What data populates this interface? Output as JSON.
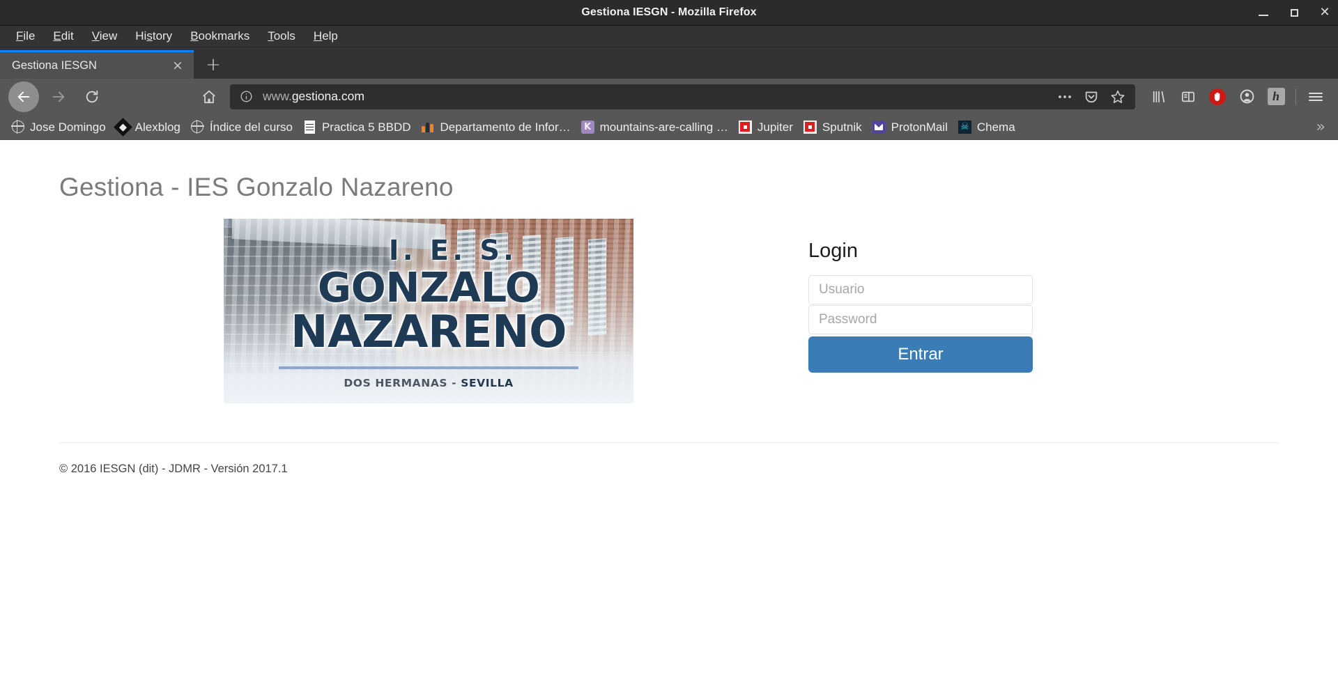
{
  "window": {
    "title": "Gestiona IESGN - Mozilla Firefox",
    "controls": {
      "minimize": "minimize-icon",
      "maximize": "maximize-icon",
      "close": "close-icon"
    }
  },
  "menubar": [
    {
      "label": "File",
      "accel": "F"
    },
    {
      "label": "Edit",
      "accel": "E"
    },
    {
      "label": "View",
      "accel": "V"
    },
    {
      "label": "History",
      "accel": "s"
    },
    {
      "label": "Bookmarks",
      "accel": "B"
    },
    {
      "label": "Tools",
      "accel": "T"
    },
    {
      "label": "Help",
      "accel": "H"
    }
  ],
  "tabs": {
    "active": {
      "title": "Gestiona IESGN",
      "close": "×"
    },
    "new_tab": "+"
  },
  "toolbar": {
    "back": "back-arrow-icon",
    "forward": "forward-arrow-icon",
    "reload": "reload-icon",
    "home": "home-icon",
    "url": {
      "scheme_host_dim": "www.",
      "host": "gestiona.com",
      "info_icon": "info-icon"
    },
    "url_actions": {
      "page_actions": "…",
      "pocket": "pocket-icon",
      "bookmark_star": "star-icon"
    },
    "extensions": [
      {
        "name": "library-icon"
      },
      {
        "name": "sidebar-icon"
      },
      {
        "name": "ublock-origin-icon"
      },
      {
        "name": "account-icon"
      },
      {
        "name": "hypothesis-icon",
        "glyph": "h"
      }
    ],
    "menu": "hamburger-menu-icon"
  },
  "bookmarks": {
    "items": [
      {
        "label": "Jose Domingo",
        "icon": "globe-icon"
      },
      {
        "label": "Alexblog",
        "icon": "diamond-icon"
      },
      {
        "label": "Índice del curso",
        "icon": "globe-icon"
      },
      {
        "label": "Practica 5 BBDD",
        "icon": "document-icon"
      },
      {
        "label": "Departamento de Infor…",
        "icon": "moodle-icon"
      },
      {
        "label": "mountains-are-calling …",
        "icon": "purple-k-icon"
      },
      {
        "label": "Jupiter",
        "icon": "red-square-icon"
      },
      {
        "label": "Sputnik",
        "icon": "red-square-icon"
      },
      {
        "label": "ProtonMail",
        "icon": "protonmail-icon"
      },
      {
        "label": "Chema",
        "icon": "skull-icon"
      }
    ],
    "overflow": "»"
  },
  "page": {
    "title": "Gestiona - IES Gonzalo Nazareno",
    "banner": {
      "line1": "I. E. S.",
      "line2": "GONZALO",
      "line3": "NAZARENO",
      "subtitle_plain": "DOS HERMANAS - ",
      "subtitle_strong": "SEVILLA"
    },
    "login": {
      "heading": "Login",
      "user_placeholder": "Usuario",
      "user_value": "",
      "password_placeholder": "Password",
      "password_value": "",
      "submit_label": "Entrar"
    },
    "footer": "© 2016 IESGN (dit) - JDMR - Versión 2017.1"
  },
  "colors": {
    "titlebar_bg": "#2b2b2b",
    "chrome_bg": "#575757",
    "tab_active_indicator": "#0a84ff",
    "primary_button": "#3a7cb5",
    "page_title": "#7b7b7b",
    "banner_text": "#1f3a54"
  }
}
